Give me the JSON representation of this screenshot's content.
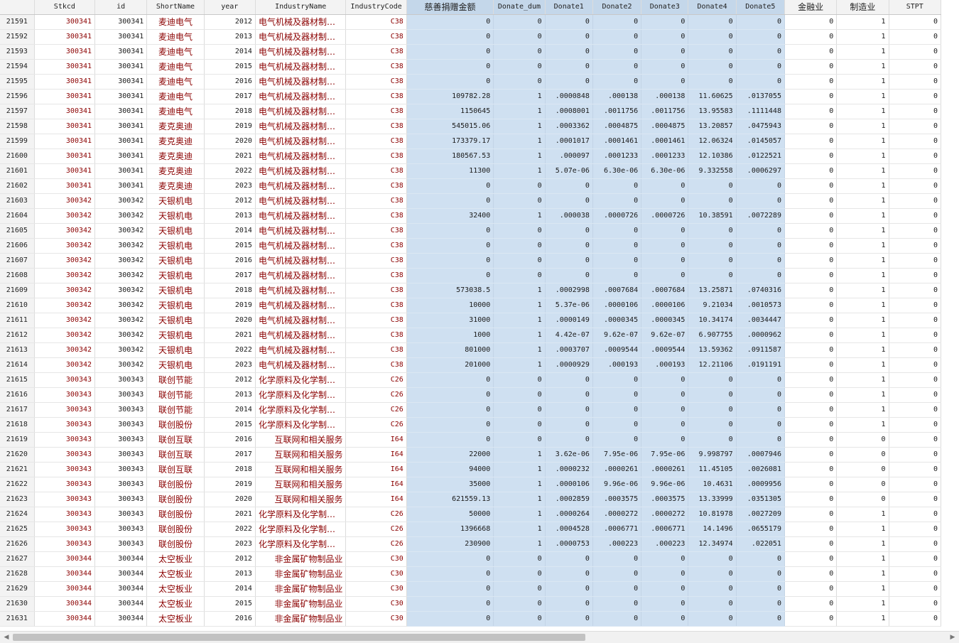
{
  "columns": [
    "",
    "Stkcd",
    "id",
    "ShortName",
    "year",
    "IndustryName",
    "IndustryCode",
    "慈善捐赠金额",
    "Donate_dum",
    "Donate1",
    "Donate2",
    "Donate3",
    "Donate4",
    "Donate5",
    "金融业",
    "制造业",
    "STPT"
  ],
  "rows": [
    [
      "21591",
      "300341",
      "300341",
      "麦迪电气",
      "2012",
      "电气机械及器材制造…",
      "C38",
      "0",
      "0",
      "0",
      "0",
      "0",
      "0",
      "0",
      "0",
      "1",
      "0"
    ],
    [
      "21592",
      "300341",
      "300341",
      "麦迪电气",
      "2013",
      "电气机械及器材制造…",
      "C38",
      "0",
      "0",
      "0",
      "0",
      "0",
      "0",
      "0",
      "0",
      "1",
      "0"
    ],
    [
      "21593",
      "300341",
      "300341",
      "麦迪电气",
      "2014",
      "电气机械及器材制造…",
      "C38",
      "0",
      "0",
      "0",
      "0",
      "0",
      "0",
      "0",
      "0",
      "1",
      "0"
    ],
    [
      "21594",
      "300341",
      "300341",
      "麦迪电气",
      "2015",
      "电气机械及器材制造…",
      "C38",
      "0",
      "0",
      "0",
      "0",
      "0",
      "0",
      "0",
      "0",
      "1",
      "0"
    ],
    [
      "21595",
      "300341",
      "300341",
      "麦迪电气",
      "2016",
      "电气机械及器材制造…",
      "C38",
      "0",
      "0",
      "0",
      "0",
      "0",
      "0",
      "0",
      "0",
      "1",
      "0"
    ],
    [
      "21596",
      "300341",
      "300341",
      "麦迪电气",
      "2017",
      "电气机械及器材制造…",
      "C38",
      "109782.28",
      "1",
      ".0000848",
      ".000138",
      ".000138",
      "11.60625",
      ".0137055",
      "0",
      "1",
      "0"
    ],
    [
      "21597",
      "300341",
      "300341",
      "麦迪电气",
      "2018",
      "电气机械及器材制造…",
      "C38",
      "1150645",
      "1",
      ".0008001",
      ".0011756",
      ".0011756",
      "13.95583",
      ".1111448",
      "0",
      "1",
      "0"
    ],
    [
      "21598",
      "300341",
      "300341",
      "麦克奥迪",
      "2019",
      "电气机械及器材制造…",
      "C38",
      "545015.06",
      "1",
      ".0003362",
      ".0004875",
      ".0004875",
      "13.20857",
      ".0475943",
      "0",
      "1",
      "0"
    ],
    [
      "21599",
      "300341",
      "300341",
      "麦克奥迪",
      "2020",
      "电气机械及器材制造…",
      "C38",
      "173379.17",
      "1",
      ".0001017",
      ".0001461",
      ".0001461",
      "12.06324",
      ".0145057",
      "0",
      "1",
      "0"
    ],
    [
      "21600",
      "300341",
      "300341",
      "麦克奥迪",
      "2021",
      "电气机械及器材制造…",
      "C38",
      "180567.53",
      "1",
      ".000097",
      ".0001233",
      ".0001233",
      "12.10386",
      ".0122521",
      "0",
      "1",
      "0"
    ],
    [
      "21601",
      "300341",
      "300341",
      "麦克奥迪",
      "2022",
      "电气机械及器材制造…",
      "C38",
      "11300",
      "1",
      "5.07e-06",
      "6.30e-06",
      "6.30e-06",
      "9.332558",
      ".0006297",
      "0",
      "1",
      "0"
    ],
    [
      "21602",
      "300341",
      "300341",
      "麦克奥迪",
      "2023",
      "电气机械及器材制造…",
      "C38",
      "0",
      "0",
      "0",
      "0",
      "0",
      "0",
      "0",
      "0",
      "1",
      "0"
    ],
    [
      "21603",
      "300342",
      "300342",
      "天银机电",
      "2012",
      "电气机械及器材制造…",
      "C38",
      "0",
      "0",
      "0",
      "0",
      "0",
      "0",
      "0",
      "0",
      "1",
      "0"
    ],
    [
      "21604",
      "300342",
      "300342",
      "天银机电",
      "2013",
      "电气机械及器材制造…",
      "C38",
      "32400",
      "1",
      ".000038",
      ".0000726",
      ".0000726",
      "10.38591",
      ".0072289",
      "0",
      "1",
      "0"
    ],
    [
      "21605",
      "300342",
      "300342",
      "天银机电",
      "2014",
      "电气机械及器材制造…",
      "C38",
      "0",
      "0",
      "0",
      "0",
      "0",
      "0",
      "0",
      "0",
      "1",
      "0"
    ],
    [
      "21606",
      "300342",
      "300342",
      "天银机电",
      "2015",
      "电气机械及器材制造…",
      "C38",
      "0",
      "0",
      "0",
      "0",
      "0",
      "0",
      "0",
      "0",
      "1",
      "0"
    ],
    [
      "21607",
      "300342",
      "300342",
      "天银机电",
      "2016",
      "电气机械及器材制造…",
      "C38",
      "0",
      "0",
      "0",
      "0",
      "0",
      "0",
      "0",
      "0",
      "1",
      "0"
    ],
    [
      "21608",
      "300342",
      "300342",
      "天银机电",
      "2017",
      "电气机械及器材制造…",
      "C38",
      "0",
      "0",
      "0",
      "0",
      "0",
      "0",
      "0",
      "0",
      "1",
      "0"
    ],
    [
      "21609",
      "300342",
      "300342",
      "天银机电",
      "2018",
      "电气机械及器材制造…",
      "C38",
      "573038.5",
      "1",
      ".0002998",
      ".0007684",
      ".0007684",
      "13.25871",
      ".0740316",
      "0",
      "1",
      "0"
    ],
    [
      "21610",
      "300342",
      "300342",
      "天银机电",
      "2019",
      "电气机械及器材制造…",
      "C38",
      "10000",
      "1",
      "5.37e-06",
      ".0000106",
      ".0000106",
      "9.21034",
      ".0010573",
      "0",
      "1",
      "0"
    ],
    [
      "21611",
      "300342",
      "300342",
      "天银机电",
      "2020",
      "电气机械及器材制造…",
      "C38",
      "31000",
      "1",
      ".0000149",
      ".0000345",
      ".0000345",
      "10.34174",
      ".0034447",
      "0",
      "1",
      "0"
    ],
    [
      "21612",
      "300342",
      "300342",
      "天银机电",
      "2021",
      "电气机械及器材制造…",
      "C38",
      "1000",
      "1",
      "4.42e-07",
      "9.62e-07",
      "9.62e-07",
      "6.907755",
      ".0000962",
      "0",
      "1",
      "0"
    ],
    [
      "21613",
      "300342",
      "300342",
      "天银机电",
      "2022",
      "电气机械及器材制造…",
      "C38",
      "801000",
      "1",
      ".0003707",
      ".0009544",
      ".0009544",
      "13.59362",
      ".0911587",
      "0",
      "1",
      "0"
    ],
    [
      "21614",
      "300342",
      "300342",
      "天银机电",
      "2023",
      "电气机械及器材制造…",
      "C38",
      "201000",
      "1",
      ".0000929",
      ".000193",
      ".000193",
      "12.21106",
      ".0191191",
      "0",
      "1",
      "0"
    ],
    [
      "21615",
      "300343",
      "300343",
      "联创节能",
      "2012",
      "化学原料及化学制品…",
      "C26",
      "0",
      "0",
      "0",
      "0",
      "0",
      "0",
      "0",
      "0",
      "1",
      "0"
    ],
    [
      "21616",
      "300343",
      "300343",
      "联创节能",
      "2013",
      "化学原料及化学制品…",
      "C26",
      "0",
      "0",
      "0",
      "0",
      "0",
      "0",
      "0",
      "0",
      "1",
      "0"
    ],
    [
      "21617",
      "300343",
      "300343",
      "联创节能",
      "2014",
      "化学原料及化学制品…",
      "C26",
      "0",
      "0",
      "0",
      "0",
      "0",
      "0",
      "0",
      "0",
      "1",
      "0"
    ],
    [
      "21618",
      "300343",
      "300343",
      "联创股份",
      "2015",
      "化学原料及化学制品…",
      "C26",
      "0",
      "0",
      "0",
      "0",
      "0",
      "0",
      "0",
      "0",
      "1",
      "0"
    ],
    [
      "21619",
      "300343",
      "300343",
      "联创互联",
      "2016",
      "互联网和相关服务",
      "I64",
      "0",
      "0",
      "0",
      "0",
      "0",
      "0",
      "0",
      "0",
      "0",
      "0"
    ],
    [
      "21620",
      "300343",
      "300343",
      "联创互联",
      "2017",
      "互联网和相关服务",
      "I64",
      "22000",
      "1",
      "3.62e-06",
      "7.95e-06",
      "7.95e-06",
      "9.998797",
      ".0007946",
      "0",
      "0",
      "0"
    ],
    [
      "21621",
      "300343",
      "300343",
      "联创互联",
      "2018",
      "互联网和相关服务",
      "I64",
      "94000",
      "1",
      ".0000232",
      ".0000261",
      ".0000261",
      "11.45105",
      ".0026081",
      "0",
      "0",
      "0"
    ],
    [
      "21622",
      "300343",
      "300343",
      "联创股份",
      "2019",
      "互联网和相关服务",
      "I64",
      "35000",
      "1",
      ".0000106",
      "9.96e-06",
      "9.96e-06",
      "10.4631",
      ".0009956",
      "0",
      "0",
      "0"
    ],
    [
      "21623",
      "300343",
      "300343",
      "联创股份",
      "2020",
      "互联网和相关服务",
      "I64",
      "621559.13",
      "1",
      ".0002859",
      ".0003575",
      ".0003575",
      "13.33999",
      ".0351305",
      "0",
      "0",
      "0"
    ],
    [
      "21624",
      "300343",
      "300343",
      "联创股份",
      "2021",
      "化学原料及化学制品…",
      "C26",
      "50000",
      "1",
      ".0000264",
      ".0000272",
      ".0000272",
      "10.81978",
      ".0027209",
      "0",
      "1",
      "0"
    ],
    [
      "21625",
      "300343",
      "300343",
      "联创股份",
      "2022",
      "化学原料及化学制品…",
      "C26",
      "1396668",
      "1",
      ".0004528",
      ".0006771",
      ".0006771",
      "14.1496",
      ".0655179",
      "0",
      "1",
      "0"
    ],
    [
      "21626",
      "300343",
      "300343",
      "联创股份",
      "2023",
      "化学原料及化学制品…",
      "C26",
      "230900",
      "1",
      ".0000753",
      ".000223",
      ".000223",
      "12.34974",
      ".022051",
      "0",
      "1",
      "0"
    ],
    [
      "21627",
      "300344",
      "300344",
      "太空板业",
      "2012",
      "非金属矿物制品业",
      "C30",
      "0",
      "0",
      "0",
      "0",
      "0",
      "0",
      "0",
      "0",
      "1",
      "0"
    ],
    [
      "21628",
      "300344",
      "300344",
      "太空板业",
      "2013",
      "非金属矿物制品业",
      "C30",
      "0",
      "0",
      "0",
      "0",
      "0",
      "0",
      "0",
      "0",
      "1",
      "0"
    ],
    [
      "21629",
      "300344",
      "300344",
      "太空板业",
      "2014",
      "非金属矿物制品业",
      "C30",
      "0",
      "0",
      "0",
      "0",
      "0",
      "0",
      "0",
      "0",
      "1",
      "0"
    ],
    [
      "21630",
      "300344",
      "300344",
      "太空板业",
      "2015",
      "非金属矿物制品业",
      "C30",
      "0",
      "0",
      "0",
      "0",
      "0",
      "0",
      "0",
      "0",
      "1",
      "0"
    ],
    [
      "21631",
      "300344",
      "300344",
      "太空板业",
      "2016",
      "非金属矿物制品业",
      "C30",
      "0",
      "0",
      "0",
      "0",
      "0",
      "0",
      "0",
      "0",
      "1",
      "0"
    ]
  ],
  "selected_columns": [
    "慈善捐赠金额",
    "Donate_dum",
    "Donate1",
    "Donate2",
    "Donate3",
    "Donate4",
    "Donate5"
  ],
  "colors": {
    "selection": "#cfe0f1",
    "header": "#f3f3f3",
    "key_text": "#8b0000"
  },
  "scrollbar": {
    "left_arrow": "◀",
    "right_arrow": "▶"
  }
}
